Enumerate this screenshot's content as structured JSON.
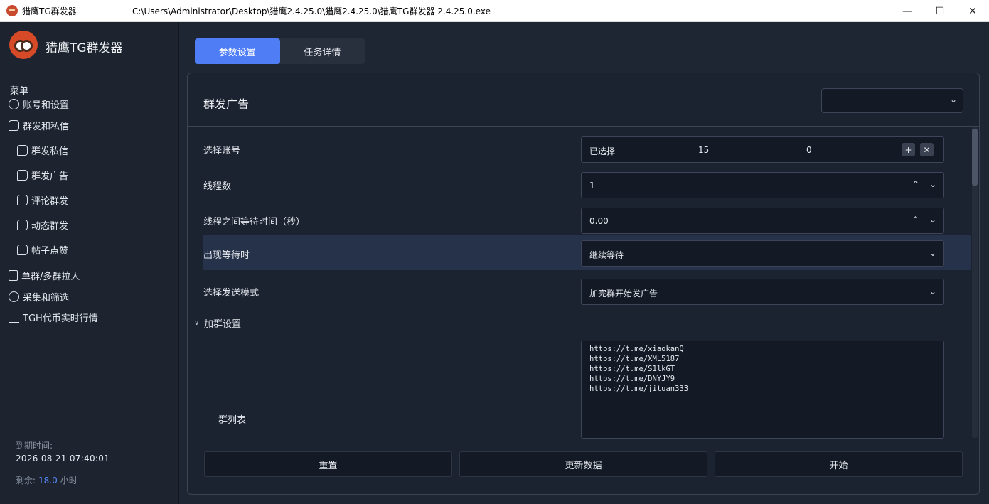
{
  "window": {
    "app_name": "猎鹰TG群发器",
    "path": "C:\\Users\\Administrator\\Desktop\\猎鹰2.4.25.0\\猎鹰2.4.25.0\\猎鹰TG群发器 2.4.25.0.exe",
    "minimize": "—",
    "maximize": "☐",
    "close": "✕"
  },
  "sidebar": {
    "brand": "猎鹰TG群发器",
    "menu_heading": "菜单",
    "items": [
      {
        "label": "账号和设置",
        "icon": "user-circle-icon"
      },
      {
        "label": "群发和私信",
        "icon": "chat-bubble-icon"
      },
      {
        "label": "群发私信",
        "icon": "chat-bubble-icon"
      },
      {
        "label": "群发广告",
        "icon": "chat-bubbles-icon"
      },
      {
        "label": "评论群发",
        "icon": "comment-search-icon"
      },
      {
        "label": "动态群发",
        "icon": "chat-bubble-icon"
      },
      {
        "label": "帖子点赞",
        "icon": "chat-bubble-icon"
      },
      {
        "label": "单群/多群拉人",
        "icon": "document-icon"
      },
      {
        "label": "采集和筛选",
        "icon": "target-icon"
      },
      {
        "label": "TGH代币实时行情",
        "icon": "chart-icon"
      }
    ],
    "expiry_label": "到期时间:",
    "expiry_value": "2026 08 21 07:40:01",
    "remain_label": "剩余:",
    "remain_value": "18.0",
    "remain_unit": "小时"
  },
  "tabs": [
    {
      "label": "参数设置",
      "active": true
    },
    {
      "label": "任务详情",
      "active": false
    }
  ],
  "panel": {
    "title": "群发广告",
    "rows": [
      {
        "label": "选择账号",
        "selected_label": "已选择",
        "count1": "15",
        "count2": "0"
      },
      {
        "label": "线程数",
        "value": "1"
      },
      {
        "label": "线程之间等待时间（秒）",
        "value": "0.00"
      },
      {
        "label": "出现等待时",
        "value": "继续等待"
      },
      {
        "label": "选择发送模式",
        "value": "加完群开始发广告"
      }
    ],
    "section_title": "加群设置",
    "group_list_label": "群列表",
    "group_list": [
      "https://t.me/xiaokanQ",
      "https://t.me/XML5187",
      "https://t.me/S1lkGT",
      "https://t.me/DNYJY9",
      "https://t.me/jituan333"
    ],
    "buttons": {
      "reset": "重置",
      "refresh": "更新数据",
      "start": "开始"
    }
  },
  "colors": {
    "accent": "#4f7df5",
    "background": "#1f2633",
    "panel": "#1b2230",
    "highlight_row": "#253249"
  }
}
